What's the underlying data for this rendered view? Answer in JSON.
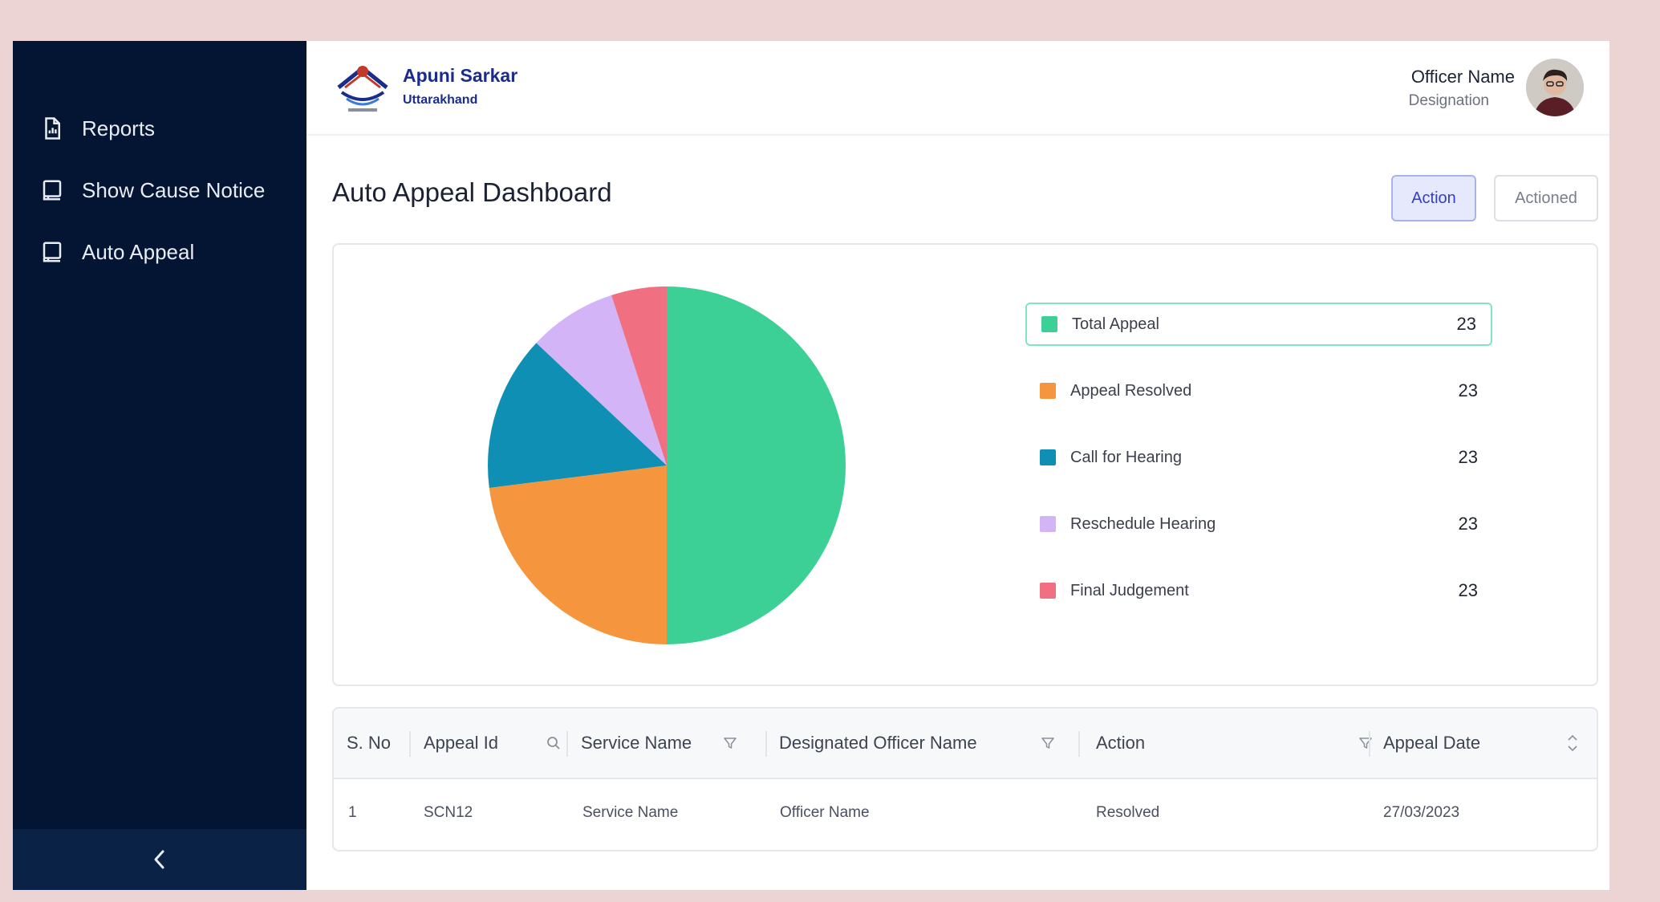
{
  "sidebar": {
    "items": [
      {
        "label": "Reports",
        "icon": "report-icon"
      },
      {
        "label": "Show Cause Notice",
        "icon": "document-icon"
      },
      {
        "label": "Auto Appeal",
        "icon": "document-icon"
      }
    ],
    "collapse_icon": "chevron-left-icon"
  },
  "header": {
    "brand_name": "Apuni Sarkar",
    "brand_sub": "Uttarakhand",
    "officer_name": "Officer Name",
    "officer_designation": "Designation"
  },
  "page": {
    "title": "Auto Appeal Dashboard",
    "tabs": [
      {
        "label": "Action",
        "selected": true
      },
      {
        "label": "Actioned",
        "selected": false
      }
    ]
  },
  "chart_data": {
    "type": "pie",
    "slices": [
      {
        "label": "Total Appeal",
        "value": 50,
        "color": "#3ccf96"
      },
      {
        "label": "Appeal Resolved",
        "value": 23,
        "color": "#f5963f"
      },
      {
        "label": "Call for Hearing",
        "value": 14,
        "color": "#0e8fb3"
      },
      {
        "label": "Reschedule Hearing",
        "value": 8,
        "color": "#d3b4f7"
      },
      {
        "label": "Final Judgement",
        "value": 5,
        "color": "#f06f80"
      }
    ]
  },
  "legend": [
    {
      "label": "Total Appeal",
      "count": "23",
      "color": "#3ccf96"
    },
    {
      "label": "Appeal Resolved",
      "count": "23",
      "color": "#f5963f"
    },
    {
      "label": "Call for Hearing",
      "count": "23",
      "color": "#0e8fb3"
    },
    {
      "label": "Reschedule Hearing",
      "count": "23",
      "color": "#d3b4f7"
    },
    {
      "label": "Final Judgement",
      "count": "23",
      "color": "#f06f80"
    }
  ],
  "table": {
    "columns": [
      "S. No",
      "Appeal Id",
      "Service Name",
      "Designated Officer Name",
      "Action",
      "Appeal Date"
    ],
    "rows": [
      [
        "1",
        "SCN12",
        "Service Name",
        "Officer Name",
        "Resolved",
        "27/03/2023"
      ]
    ]
  }
}
